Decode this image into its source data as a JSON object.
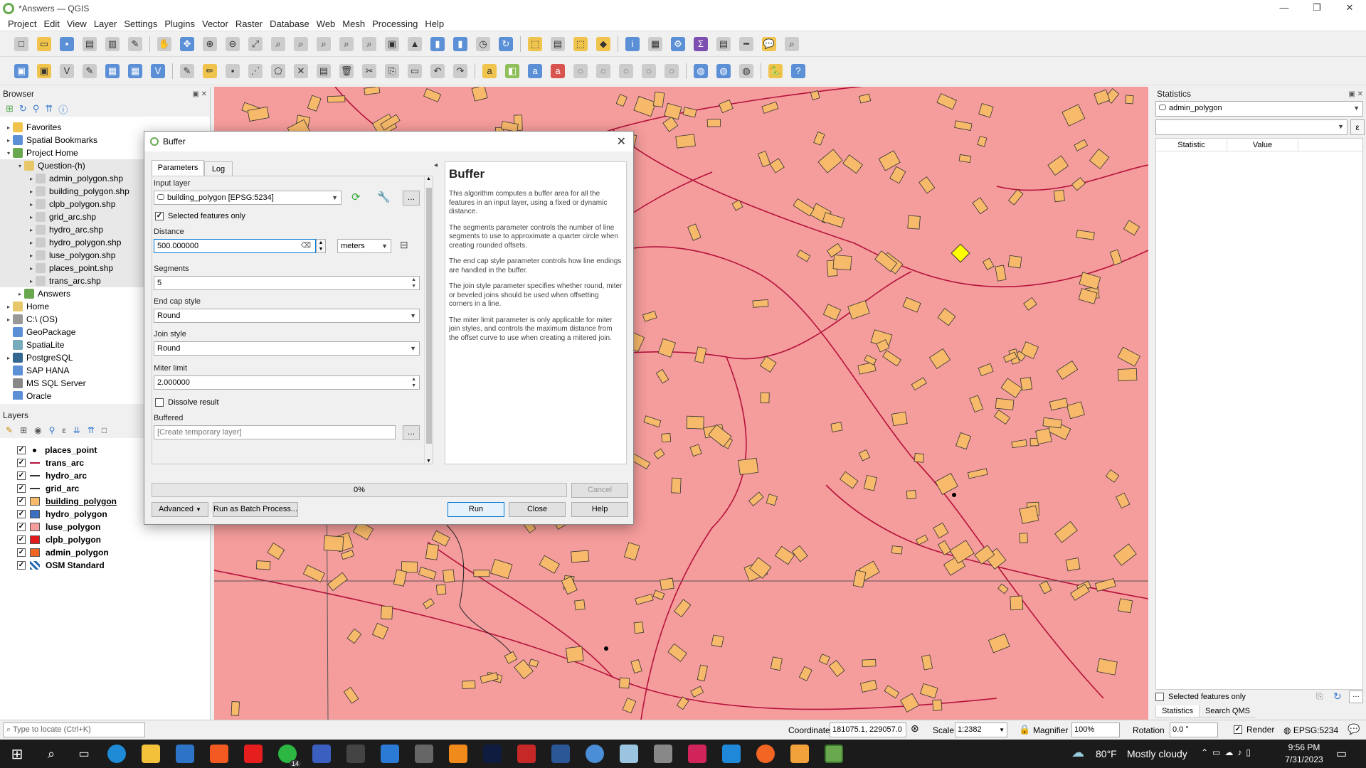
{
  "window": {
    "title": "*Answers — QGIS",
    "min": "—",
    "max": "❐",
    "close": "✕"
  },
  "menu": [
    "Project",
    "Edit",
    "View",
    "Layer",
    "Settings",
    "Plugins",
    "Vector",
    "Raster",
    "Database",
    "Web",
    "Mesh",
    "Processing",
    "Help"
  ],
  "browser": {
    "title": "Browser",
    "items": [
      {
        "label": "Favorites",
        "indent": 0,
        "exp": "▸",
        "icon": "star-icon",
        "color": "#f0c44c"
      },
      {
        "label": "Spatial Bookmarks",
        "indent": 0,
        "exp": "▸",
        "icon": "bookmark-icon",
        "color": "#5b8fd6"
      },
      {
        "label": "Project Home",
        "indent": 0,
        "exp": "▾",
        "icon": "folder-icon",
        "color": "#6aa84f"
      },
      {
        "label": "Question-(h)",
        "indent": 1,
        "exp": "▾",
        "icon": "folder-icon",
        "color": "#e8c76a"
      },
      {
        "label": "admin_polygon.shp",
        "indent": 2,
        "exp": "▸",
        "icon": "shapefile-icon",
        "color": "#ccc"
      },
      {
        "label": "building_polygon.shp",
        "indent": 2,
        "exp": "▸",
        "icon": "shapefile-icon",
        "color": "#ccc"
      },
      {
        "label": "clpb_polygon.shp",
        "indent": 2,
        "exp": "▸",
        "icon": "shapefile-icon",
        "color": "#ccc"
      },
      {
        "label": "grid_arc.shp",
        "indent": 2,
        "exp": "▸",
        "icon": "shapefile-icon",
        "color": "#ccc"
      },
      {
        "label": "hydro_arc.shp",
        "indent": 2,
        "exp": "▸",
        "icon": "shapefile-icon",
        "color": "#ccc"
      },
      {
        "label": "hydro_polygon.shp",
        "indent": 2,
        "exp": "▸",
        "icon": "shapefile-icon",
        "color": "#ccc"
      },
      {
        "label": "luse_polygon.shp",
        "indent": 2,
        "exp": "▸",
        "icon": "shapefile-icon",
        "color": "#ccc"
      },
      {
        "label": "places_point.shp",
        "indent": 2,
        "exp": "▸",
        "icon": "shapefile-icon",
        "color": "#ccc"
      },
      {
        "label": "trans_arc.shp",
        "indent": 2,
        "exp": "▸",
        "icon": "shapefile-icon",
        "color": "#ccc"
      },
      {
        "label": "Answers",
        "indent": 1,
        "exp": "▸",
        "icon": "qgis-project-icon",
        "color": "#6aa84f"
      },
      {
        "label": "Home",
        "indent": 0,
        "exp": "▸",
        "icon": "folder-icon",
        "color": "#e8c76a"
      },
      {
        "label": "C:\\ (OS)",
        "indent": 0,
        "exp": "▸",
        "icon": "drive-icon",
        "color": "#999"
      },
      {
        "label": "GeoPackage",
        "indent": 0,
        "exp": "",
        "icon": "geopackage-icon",
        "color": "#5b8fd6"
      },
      {
        "label": "SpatiaLite",
        "indent": 0,
        "exp": "",
        "icon": "spatialite-icon",
        "color": "#7ab"
      },
      {
        "label": "PostgreSQL",
        "indent": 0,
        "exp": "▸",
        "icon": "postgresql-icon",
        "color": "#336791"
      },
      {
        "label": "SAP HANA",
        "indent": 0,
        "exp": "",
        "icon": "database-icon",
        "color": "#5b8fd6"
      },
      {
        "label": "MS SQL Server",
        "indent": 0,
        "exp": "",
        "icon": "database-icon",
        "color": "#888"
      },
      {
        "label": "Oracle",
        "indent": 0,
        "exp": "",
        "icon": "database-icon",
        "color": "#5b8fd6"
      }
    ]
  },
  "layers": {
    "title": "Layers",
    "items": [
      {
        "label": "places_point",
        "sym": "point",
        "color": "#000",
        "underline": false
      },
      {
        "label": "trans_arc",
        "sym": "line",
        "color": "#b5123a",
        "underline": false
      },
      {
        "label": "hydro_arc",
        "sym": "line",
        "color": "#333",
        "underline": false
      },
      {
        "label": "grid_arc",
        "sym": "line",
        "color": "#333",
        "underline": false
      },
      {
        "label": "building_polygon",
        "sym": "fill",
        "color": "#f7b96a",
        "underline": true
      },
      {
        "label": "hydro_polygon",
        "sym": "fill",
        "color": "#3a6fc2",
        "underline": false
      },
      {
        "label": "luse_polygon",
        "sym": "fill",
        "color": "#f59c9c",
        "underline": false
      },
      {
        "label": "clpb_polygon",
        "sym": "fill",
        "color": "#e31a1c",
        "underline": false
      },
      {
        "label": "admin_polygon",
        "sym": "fill",
        "color": "#f26522",
        "underline": false
      },
      {
        "label": "OSM Standard",
        "sym": "grid",
        "color": "#2a6ab0",
        "underline": false
      }
    ]
  },
  "dialog": {
    "title": "Buffer",
    "tabs": [
      "Parameters",
      "Log"
    ],
    "input_layer_label": "Input layer",
    "input_layer_value": "building_polygon [EPSG:5234]",
    "selected_only_label": "Selected features only",
    "distance_label": "Distance",
    "distance_value": "500.000000",
    "distance_unit": "meters",
    "segments_label": "Segments",
    "segments_value": "5",
    "endcap_label": "End cap style",
    "endcap_value": "Round",
    "join_label": "Join style",
    "join_value": "Round",
    "miter_label": "Miter limit",
    "miter_value": "2.000000",
    "dissolve_label": "Dissolve result",
    "buffered_label": "Buffered",
    "buffered_placeholder": "[Create temporary layer]",
    "browse_label": "…",
    "progress_text": "0%",
    "progress": 0,
    "cancel": "Cancel",
    "advanced": "Advanced",
    "batch": "Run as Batch Process...",
    "run": "Run",
    "close": "Close",
    "help_btn": "Help",
    "help": {
      "title": "Buffer",
      "p1": "This algorithm computes a buffer area for all the features in an input layer, using a fixed or dynamic distance.",
      "p2": "The segments parameter controls the number of line segments to use to approximate a quarter circle when creating rounded offsets.",
      "p3": "The end cap style parameter controls how line endings are handled in the buffer.",
      "p4": "The join style parameter specifies whether round, miter or beveled joins should be used when offsetting corners in a line.",
      "p5": "The miter limit parameter is only applicable for miter join styles, and controls the maximum distance from the offset curve to use when creating a mitered join."
    }
  },
  "statistics": {
    "title": "Statistics",
    "layer": "admin_polygon",
    "col_statistic": "Statistic",
    "col_value": "Value",
    "selected_only": "Selected features only",
    "tab1": "Statistics",
    "tab2": "Search QMS"
  },
  "status": {
    "locator_placeholder": "Type to locate (Ctrl+K)",
    "coordinate_label": "Coordinate",
    "coordinate": "181075.1, 229057.0",
    "scale_label": "Scale",
    "scale": "1:2382",
    "magnifier_label": "Magnifier",
    "magnifier": "100%",
    "rotation_label": "Rotation",
    "rotation": "0.0 °",
    "render_label": "Render",
    "crs": "EPSG:5234"
  },
  "taskbar": {
    "weather_temp": "80°F",
    "weather_desc": "Mostly cloudy",
    "time": "9:56 PM",
    "date": "7/31/2023",
    "whatsapp_badge": "14"
  },
  "colors": {
    "map_bg": "#f59c9c",
    "building": "#f7b96a",
    "road": "#b5123a",
    "selection": "#ffff00",
    "accent": "#0078d7"
  }
}
